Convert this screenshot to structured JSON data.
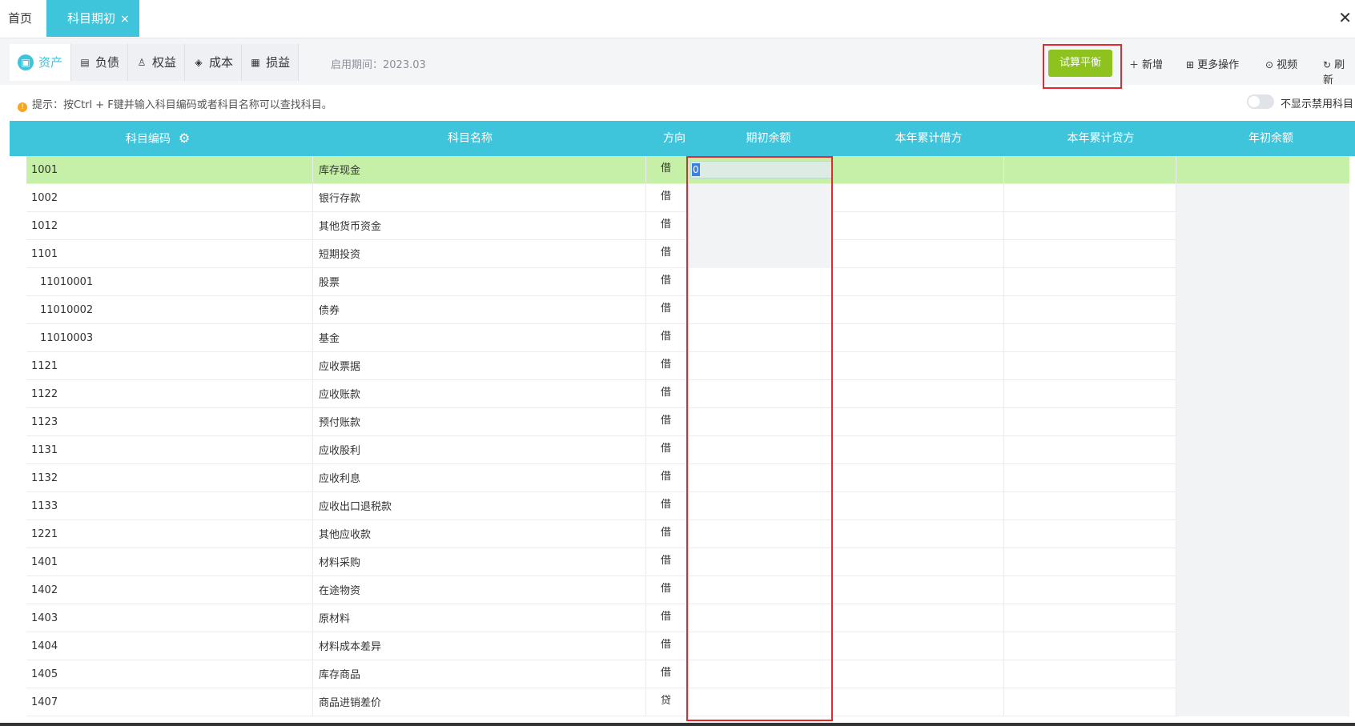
{
  "tabs": {
    "home": "首页",
    "active": "科目期初",
    "active_close": "×",
    "window_close": "✕"
  },
  "categories": [
    {
      "label": "资产",
      "icon": "asset-icon"
    },
    {
      "label": "负债",
      "icon": "liability-icon"
    },
    {
      "label": "权益",
      "icon": "equity-icon"
    },
    {
      "label": "成本",
      "icon": "layers-icon"
    },
    {
      "label": "损益",
      "icon": "profit-loss-icon"
    }
  ],
  "period": {
    "label": "启用期间：",
    "value": "2023.03"
  },
  "toolbar": {
    "trial_balance": "试算平衡",
    "add": "新增",
    "more": "更多操作",
    "video": "视频",
    "refresh": "刷新"
  },
  "tip": "提示：按Ctrl + F键并输入科目编码或者科目名称可以查找科目。",
  "toggle_label": "不显示禁用科目",
  "table": {
    "headers": [
      "科目编码",
      "科目名称",
      "方向",
      "期初余额",
      "本年累计借方",
      "本年累计贷方",
      "年初余额"
    ],
    "rows": [
      {
        "code": "1001",
        "name": "库存现金",
        "dir": "借",
        "open": "0"
      },
      {
        "code": "1002",
        "name": "银行存款",
        "dir": "借",
        "open": ""
      },
      {
        "code": "1012",
        "name": "其他货币资金",
        "dir": "借",
        "open": ""
      },
      {
        "code": "1101",
        "name": "短期投资",
        "dir": "借",
        "open": ""
      },
      {
        "code": "11010001",
        "name": "股票",
        "dir": "借",
        "open": ""
      },
      {
        "code": "11010002",
        "name": "债券",
        "dir": "借",
        "open": ""
      },
      {
        "code": "11010003",
        "name": "基金",
        "dir": "借",
        "open": ""
      },
      {
        "code": "1121",
        "name": "应收票据",
        "dir": "借",
        "open": ""
      },
      {
        "code": "1122",
        "name": "应收账款",
        "dir": "借",
        "open": ""
      },
      {
        "code": "1123",
        "name": "预付账款",
        "dir": "借",
        "open": ""
      },
      {
        "code": "1131",
        "name": "应收股利",
        "dir": "借",
        "open": ""
      },
      {
        "code": "1132",
        "name": "应收利息",
        "dir": "借",
        "open": ""
      },
      {
        "code": "1133",
        "name": "应收出口退税款",
        "dir": "借",
        "open": ""
      },
      {
        "code": "1221",
        "name": "其他应收款",
        "dir": "借",
        "open": ""
      },
      {
        "code": "1401",
        "name": "材料采购",
        "dir": "借",
        "open": ""
      },
      {
        "code": "1402",
        "name": "在途物资",
        "dir": "借",
        "open": ""
      },
      {
        "code": "1403",
        "name": "原材料",
        "dir": "借",
        "open": ""
      },
      {
        "code": "1404",
        "name": "材料成本差异",
        "dir": "借",
        "open": ""
      },
      {
        "code": "1405",
        "name": "库存商品",
        "dir": "借",
        "open": ""
      },
      {
        "code": "1407",
        "name": "商品进销差价",
        "dir": "贷",
        "open": ""
      }
    ]
  },
  "colors": {
    "accent": "#3ec5dc",
    "button_green": "#8dc21f",
    "selected_row": "#c6f0a7",
    "highlight_red": "#e8262d"
  }
}
